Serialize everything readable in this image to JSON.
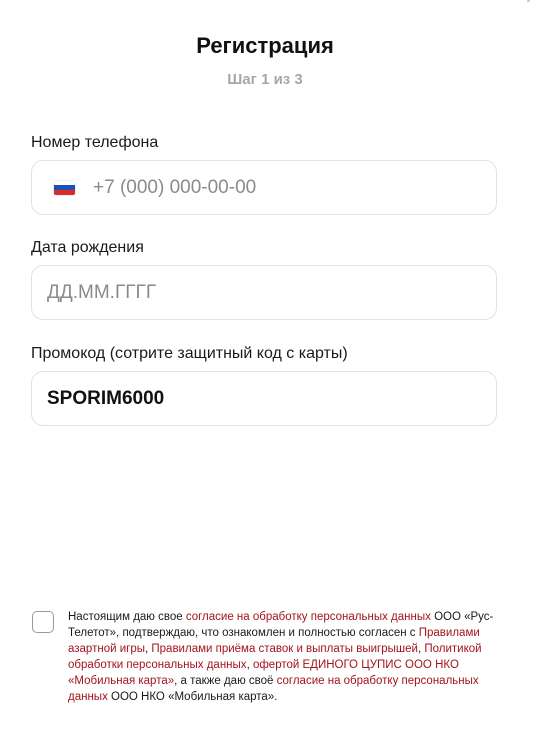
{
  "header": {
    "title": "Регистрация",
    "step": "Шаг 1 из 3"
  },
  "form": {
    "phone": {
      "label": "Номер телефона",
      "placeholder": "+7 (000) 000-00-00",
      "country_flag_icon": "russia-flag-icon"
    },
    "birthdate": {
      "label": "Дата рождения",
      "placeholder": "ДД.ММ.ГГГГ"
    },
    "promo": {
      "label": "Промокод (сотрите защитный код с карты)",
      "value": "SPORIM6000"
    }
  },
  "consent": {
    "checked": false,
    "t1": "Настоящим даю свое ",
    "l1": "согласие на обработку персональных данных",
    "t2": " ООО «Рус-Телетот», подтверждаю, что ознакомлен и полностью согласен с ",
    "l2": "Правилами азартной игры",
    "t3": ", ",
    "l3": "Правилами приёма ставок и выплаты выигрышей",
    "t4": ", ",
    "l4": "Политикой обработки персональных данных",
    "t5": ", ",
    "l5": "офертой ЕДИНОГО ЦУПИС ООО НКО «Мобильная карта»",
    "t6": ", а также даю своё ",
    "l6": "согласие на обработку персональных данных",
    "t7": " ООО НКО «Мобильная карта»."
  },
  "colors": {
    "link": "#a3141a",
    "muted": "#a7a7a7",
    "border": "#e2e2e2"
  }
}
